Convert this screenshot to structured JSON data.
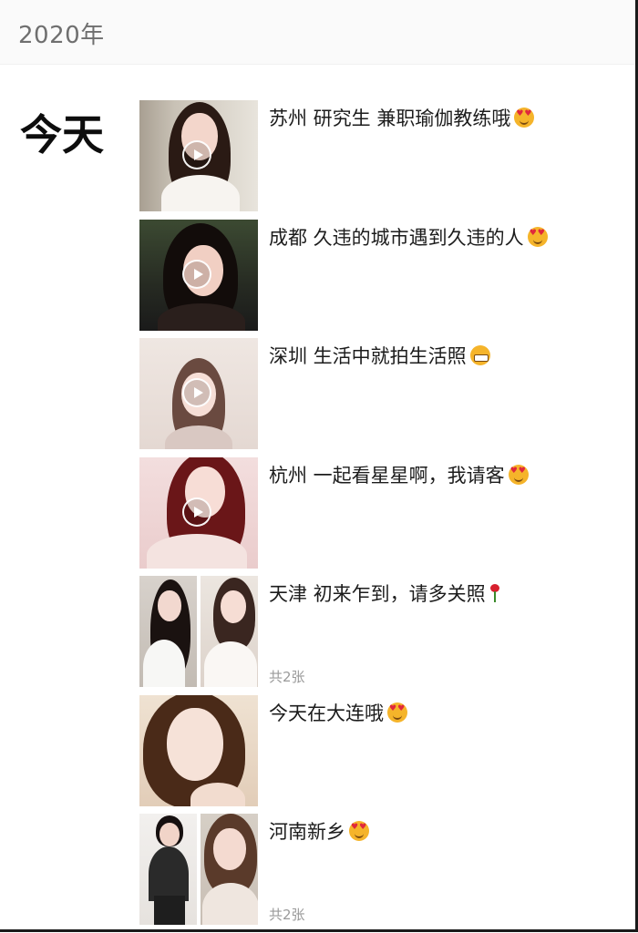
{
  "header": {
    "year": "2020年"
  },
  "day": {
    "label": "今天"
  },
  "posts": [
    {
      "caption": "苏州  研究生  兼职瑜伽教练哦",
      "emoji": "heart-eyes-emoji-icon",
      "media": "video"
    },
    {
      "caption": "成都  久违的城市遇到久违的人",
      "emoji": "heart-eyes-emoji-icon",
      "media": "video"
    },
    {
      "caption": "深圳  生活中就拍生活照",
      "emoji": "grin-emoji-icon",
      "media": "video"
    },
    {
      "caption": "杭州  一起看星星啊，我请客",
      "emoji": "heart-eyes-emoji-icon",
      "media": "video"
    },
    {
      "caption": "天津  初来乍到，请多关照",
      "emoji": "rose-emoji-icon",
      "media": "photos",
      "count": "共2张"
    },
    {
      "caption": "今天在大连哦",
      "emoji": "heart-eyes-emoji-icon",
      "media": "photo"
    },
    {
      "caption": "河南新乡",
      "emoji": "heart-eyes-emoji-icon",
      "media": "photos",
      "count": "共2张"
    }
  ],
  "colors": {
    "header_bg": "#fafafa",
    "year_text": "#6f6f6f",
    "count_text": "#9a9a9a"
  }
}
